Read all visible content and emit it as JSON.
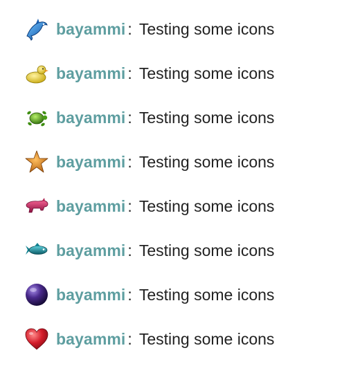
{
  "messages": [
    {
      "username": "bayammi",
      "separator": ":",
      "text": "Testing some icons",
      "icon": "dolphin-icon",
      "color": "#1e6fc0"
    },
    {
      "username": "bayammi",
      "separator": ":",
      "text": "Testing some icons",
      "icon": "duck-icon",
      "color": "#e3cc2a"
    },
    {
      "username": "bayammi",
      "separator": ":",
      "text": "Testing some icons",
      "icon": "turtle-icon",
      "color": "#58a81e"
    },
    {
      "username": "bayammi",
      "separator": ":",
      "text": "Testing some icons",
      "icon": "starfish-icon",
      "color": "#d9781c"
    },
    {
      "username": "bayammi",
      "separator": ":",
      "text": "Testing some icons",
      "icon": "pig-icon",
      "color": "#c0245a"
    },
    {
      "username": "bayammi",
      "separator": ":",
      "text": "Testing some icons",
      "icon": "fish-icon",
      "color": "#168a96"
    },
    {
      "username": "bayammi",
      "separator": ":",
      "text": "Testing some icons",
      "icon": "ball-icon",
      "color": "#4a2a8c"
    },
    {
      "username": "bayammi",
      "separator": ":",
      "text": "Testing some icons",
      "icon": "heart-icon",
      "color": "#d41c2a"
    }
  ],
  "colors": {
    "username": "#5e9ea0",
    "text": "#222222",
    "background": "#ffffff"
  }
}
